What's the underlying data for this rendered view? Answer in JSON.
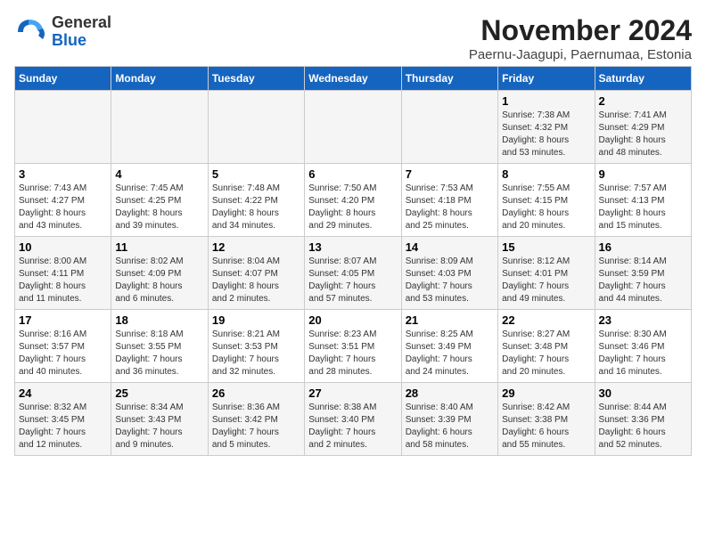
{
  "header": {
    "logo_general": "General",
    "logo_blue": "Blue",
    "month_title": "November 2024",
    "location": "Paernu-Jaagupi, Paernumaa, Estonia"
  },
  "weekdays": [
    "Sunday",
    "Monday",
    "Tuesday",
    "Wednesday",
    "Thursday",
    "Friday",
    "Saturday"
  ],
  "weeks": [
    [
      {
        "day": "",
        "info": ""
      },
      {
        "day": "",
        "info": ""
      },
      {
        "day": "",
        "info": ""
      },
      {
        "day": "",
        "info": ""
      },
      {
        "day": "",
        "info": ""
      },
      {
        "day": "1",
        "info": "Sunrise: 7:38 AM\nSunset: 4:32 PM\nDaylight: 8 hours\nand 53 minutes."
      },
      {
        "day": "2",
        "info": "Sunrise: 7:41 AM\nSunset: 4:29 PM\nDaylight: 8 hours\nand 48 minutes."
      }
    ],
    [
      {
        "day": "3",
        "info": "Sunrise: 7:43 AM\nSunset: 4:27 PM\nDaylight: 8 hours\nand 43 minutes."
      },
      {
        "day": "4",
        "info": "Sunrise: 7:45 AM\nSunset: 4:25 PM\nDaylight: 8 hours\nand 39 minutes."
      },
      {
        "day": "5",
        "info": "Sunrise: 7:48 AM\nSunset: 4:22 PM\nDaylight: 8 hours\nand 34 minutes."
      },
      {
        "day": "6",
        "info": "Sunrise: 7:50 AM\nSunset: 4:20 PM\nDaylight: 8 hours\nand 29 minutes."
      },
      {
        "day": "7",
        "info": "Sunrise: 7:53 AM\nSunset: 4:18 PM\nDaylight: 8 hours\nand 25 minutes."
      },
      {
        "day": "8",
        "info": "Sunrise: 7:55 AM\nSunset: 4:15 PM\nDaylight: 8 hours\nand 20 minutes."
      },
      {
        "day": "9",
        "info": "Sunrise: 7:57 AM\nSunset: 4:13 PM\nDaylight: 8 hours\nand 15 minutes."
      }
    ],
    [
      {
        "day": "10",
        "info": "Sunrise: 8:00 AM\nSunset: 4:11 PM\nDaylight: 8 hours\nand 11 minutes."
      },
      {
        "day": "11",
        "info": "Sunrise: 8:02 AM\nSunset: 4:09 PM\nDaylight: 8 hours\nand 6 minutes."
      },
      {
        "day": "12",
        "info": "Sunrise: 8:04 AM\nSunset: 4:07 PM\nDaylight: 8 hours\nand 2 minutes."
      },
      {
        "day": "13",
        "info": "Sunrise: 8:07 AM\nSunset: 4:05 PM\nDaylight: 7 hours\nand 57 minutes."
      },
      {
        "day": "14",
        "info": "Sunrise: 8:09 AM\nSunset: 4:03 PM\nDaylight: 7 hours\nand 53 minutes."
      },
      {
        "day": "15",
        "info": "Sunrise: 8:12 AM\nSunset: 4:01 PM\nDaylight: 7 hours\nand 49 minutes."
      },
      {
        "day": "16",
        "info": "Sunrise: 8:14 AM\nSunset: 3:59 PM\nDaylight: 7 hours\nand 44 minutes."
      }
    ],
    [
      {
        "day": "17",
        "info": "Sunrise: 8:16 AM\nSunset: 3:57 PM\nDaylight: 7 hours\nand 40 minutes."
      },
      {
        "day": "18",
        "info": "Sunrise: 8:18 AM\nSunset: 3:55 PM\nDaylight: 7 hours\nand 36 minutes."
      },
      {
        "day": "19",
        "info": "Sunrise: 8:21 AM\nSunset: 3:53 PM\nDaylight: 7 hours\nand 32 minutes."
      },
      {
        "day": "20",
        "info": "Sunrise: 8:23 AM\nSunset: 3:51 PM\nDaylight: 7 hours\nand 28 minutes."
      },
      {
        "day": "21",
        "info": "Sunrise: 8:25 AM\nSunset: 3:49 PM\nDaylight: 7 hours\nand 24 minutes."
      },
      {
        "day": "22",
        "info": "Sunrise: 8:27 AM\nSunset: 3:48 PM\nDaylight: 7 hours\nand 20 minutes."
      },
      {
        "day": "23",
        "info": "Sunrise: 8:30 AM\nSunset: 3:46 PM\nDaylight: 7 hours\nand 16 minutes."
      }
    ],
    [
      {
        "day": "24",
        "info": "Sunrise: 8:32 AM\nSunset: 3:45 PM\nDaylight: 7 hours\nand 12 minutes."
      },
      {
        "day": "25",
        "info": "Sunrise: 8:34 AM\nSunset: 3:43 PM\nDaylight: 7 hours\nand 9 minutes."
      },
      {
        "day": "26",
        "info": "Sunrise: 8:36 AM\nSunset: 3:42 PM\nDaylight: 7 hours\nand 5 minutes."
      },
      {
        "day": "27",
        "info": "Sunrise: 8:38 AM\nSunset: 3:40 PM\nDaylight: 7 hours\nand 2 minutes."
      },
      {
        "day": "28",
        "info": "Sunrise: 8:40 AM\nSunset: 3:39 PM\nDaylight: 6 hours\nand 58 minutes."
      },
      {
        "day": "29",
        "info": "Sunrise: 8:42 AM\nSunset: 3:38 PM\nDaylight: 6 hours\nand 55 minutes."
      },
      {
        "day": "30",
        "info": "Sunrise: 8:44 AM\nSunset: 3:36 PM\nDaylight: 6 hours\nand 52 minutes."
      }
    ]
  ]
}
